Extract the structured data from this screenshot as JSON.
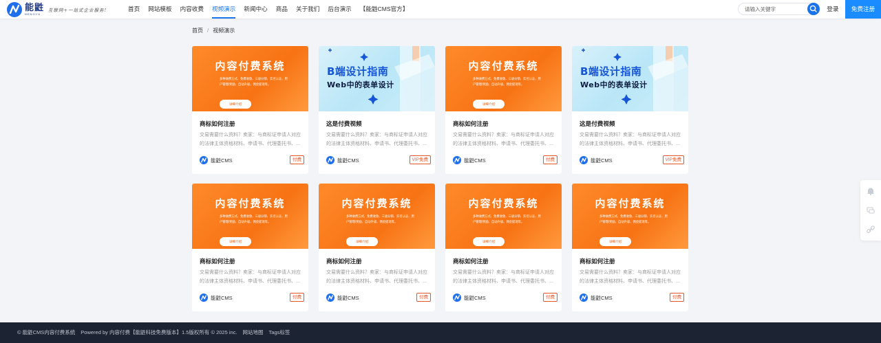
{
  "header": {
    "logo_name": "能鼪",
    "logo_sub": "NENGYU",
    "slogan": "互联网+一站式企业服务!",
    "nav": [
      "首页",
      "网站模板",
      "内容收费",
      "视频演示",
      "新闻中心",
      "商品",
      "关于我们",
      "后台演示",
      "【能鼪CMS官方】"
    ],
    "active_nav": "视频演示",
    "search_placeholder": "请输入关键字",
    "login_label": "登录",
    "register_label": "免费注册"
  },
  "breadcrumb": {
    "home": "首页",
    "separator": "/",
    "current": "视频演示"
  },
  "thumbs": {
    "orange_title": "内容付费系统",
    "orange_desc": "多种收费方式、免费收款、三级分销、实名认证、用户管理/奖励、自动升级、佣金提现等。",
    "orange_button": "详细介绍",
    "blue_title": "B端设计指南",
    "blue_sub": "Web中的表单设计"
  },
  "cards": [
    {
      "thumb": "orange",
      "title": "商标如何注册",
      "desc": "交易需要什么资料？卖家：与商标证申请人对应的法律主体资格材料、申请书、代理委托书、...",
      "author": "能鼪CMS",
      "badge": "付费"
    },
    {
      "thumb": "blue",
      "title": "这是付费视频",
      "desc": "交易需要什么资料？卖家：与商标证申请人对应的法律主体资格材料、申请书、代理委托书、...",
      "author": "能鼪CMS",
      "badge": "VIP免费"
    },
    {
      "thumb": "orange",
      "title": "商标如何注册",
      "desc": "交易需要什么资料？卖家：与商标证申请人对应的法律主体资格材料、申请书、代理委托书、...",
      "author": "能鼪CMS",
      "badge": "付费"
    },
    {
      "thumb": "blue",
      "title": "这是付费视频",
      "desc": "交易需要什么资料？卖家：与商标证申请人对应的法律主体资格材料、申请书、代理委托书、...",
      "author": "能鼪CMS",
      "badge": "VIP免费"
    },
    {
      "thumb": "orange",
      "title": "商标如何注册",
      "desc": "交易需要什么资料？卖家：与商标证申请人对应的法律主体资格材料、申请书、代理委托书、...",
      "author": "能鼪CMS",
      "badge": "付费"
    },
    {
      "thumb": "orange",
      "title": "商标如何注册",
      "desc": "交易需要什么资料？卖家：与商标证申请人对应的法律主体资格材料、申请书、代理委托书、...",
      "author": "能鼪CMS",
      "badge": "付费"
    },
    {
      "thumb": "orange",
      "title": "商标如何注册",
      "desc": "交易需要什么资料？卖家：与商标证申请人对应的法律主体资格材料、申请书、代理委托书、...",
      "author": "能鼪CMS",
      "badge": "付费"
    },
    {
      "thumb": "orange",
      "title": "商标如何注册",
      "desc": "交易需要什么资料？卖家：与商标证申请人对应的法律主体资格材料、申请书、代理委托书、...",
      "author": "能鼪CMS",
      "badge": "付费"
    }
  ],
  "side_tools": [
    "bell-icon",
    "message-icon",
    "link-icon"
  ],
  "footer": {
    "copyright": "© 能鼪CMS内容付费系统",
    "powered": "Powered by 内容付费【能鼪科技免费版本】1.5版权所有 © 2025 inc.",
    "links": [
      "网站地图",
      "Tags标签"
    ]
  },
  "colors": {
    "accent": "#1a73e8",
    "register": "#1a8cff",
    "orange": "#f77314",
    "badge": "#e4572e",
    "footer_bg": "#1c2333"
  }
}
